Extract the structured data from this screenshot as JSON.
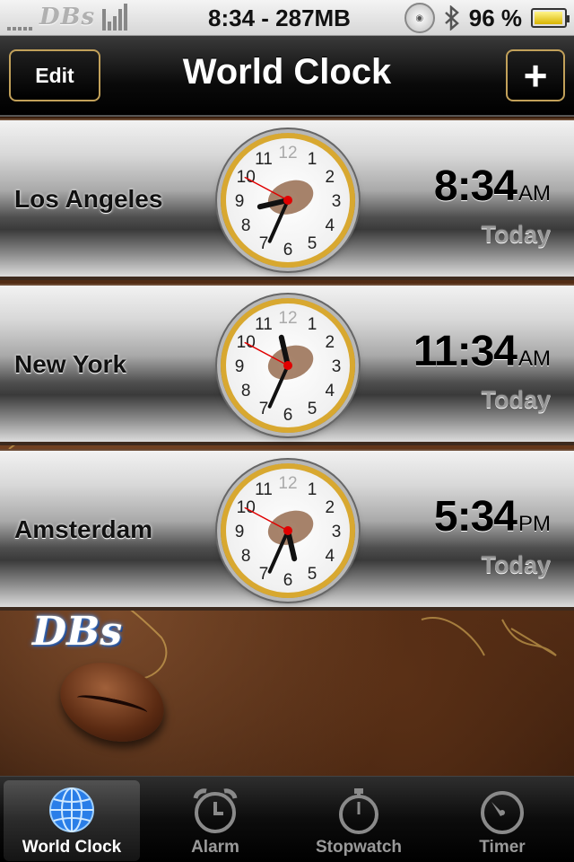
{
  "status_bar": {
    "carrier_logo": "DBs",
    "time_memory": "8:34 - 287MB",
    "battery_percent": "96 %",
    "battery_level": 0.96,
    "icons": [
      "signal-bars-icon",
      "activity-bars-icon",
      "dbs-badge-icon",
      "bluetooth-icon",
      "battery-icon"
    ]
  },
  "navbar": {
    "title": "World Clock",
    "edit_label": "Edit",
    "add_label": "+"
  },
  "clocks": [
    {
      "city": "Los Angeles",
      "time": "8:34",
      "ampm": "AM",
      "day": "Today",
      "hour": 8,
      "minute": 34
    },
    {
      "city": "New York",
      "time": "11:34",
      "ampm": "AM",
      "day": "Today",
      "hour": 11,
      "minute": 34
    },
    {
      "city": "Amsterdam",
      "time": "5:34",
      "ampm": "PM",
      "day": "Today",
      "hour": 5,
      "minute": 34
    }
  ],
  "decoration": {
    "brand_logo": "DBs"
  },
  "tabs": [
    {
      "label": "World Clock",
      "icon": "globe-icon",
      "active": true
    },
    {
      "label": "Alarm",
      "icon": "alarm-clock-icon",
      "active": false
    },
    {
      "label": "Stopwatch",
      "icon": "stopwatch-icon",
      "active": false
    },
    {
      "label": "Timer",
      "icon": "timer-icon",
      "active": false
    }
  ],
  "colors": {
    "accent_gold": "#d8a830",
    "second_hand": "#e00000"
  }
}
